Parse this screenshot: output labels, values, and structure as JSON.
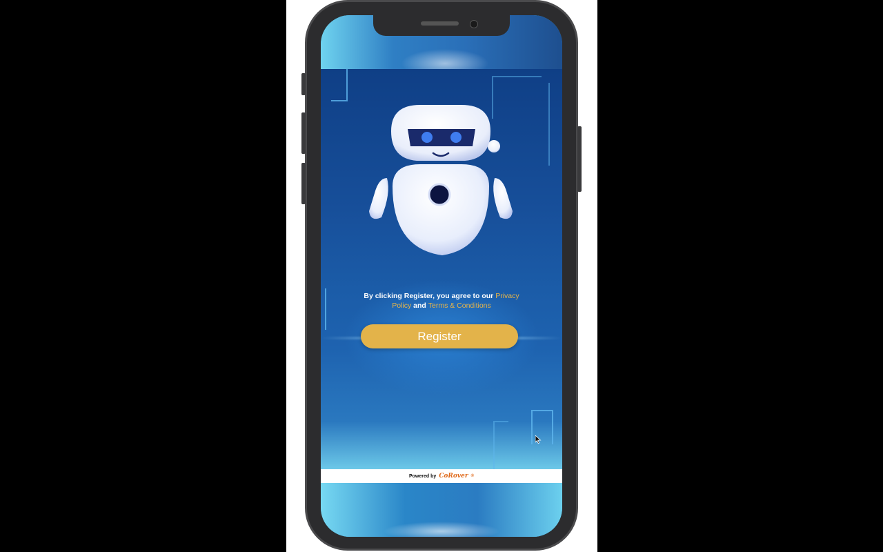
{
  "consent": {
    "prefix": "By clicking Register, you agree to our",
    "privacy_link": "Privacy Policy",
    "conjunction": "and",
    "terms_link": "Terms & Conditions"
  },
  "register_label": "Register",
  "footer": {
    "powered_by": "Powered by",
    "brand": "CoRover"
  },
  "colors": {
    "accent": "#e3b34a",
    "link": "#e8b548",
    "brand": "#e06b1c",
    "background_blue": "#1a4f98"
  },
  "icons": {
    "robot": "robot-mascot-icon",
    "cursor": "mouse-cursor-icon"
  }
}
